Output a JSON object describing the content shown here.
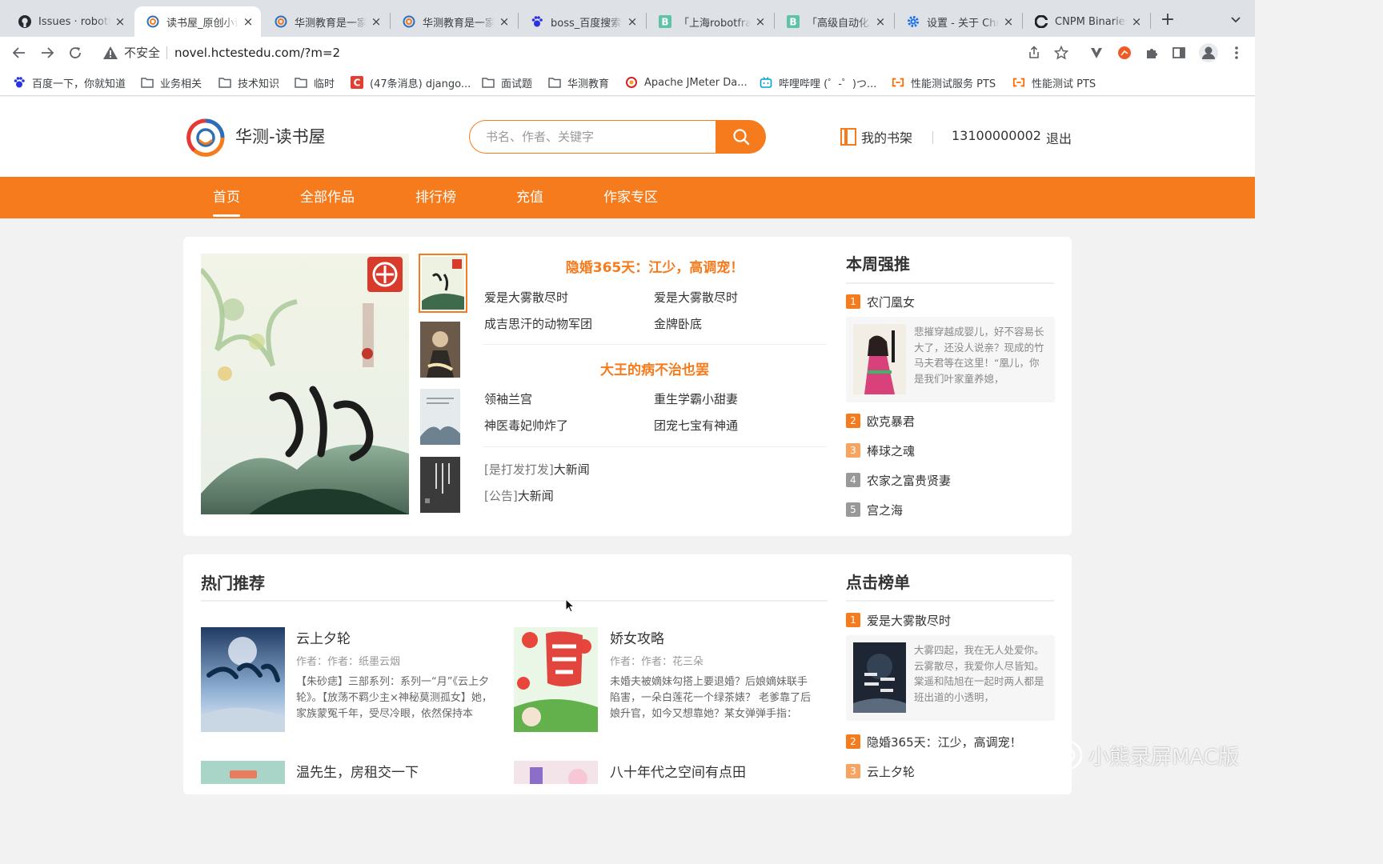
{
  "browser": {
    "tabs": [
      {
        "title": "Issues · robotframework"
      },
      {
        "title": "读书屋_原创小说"
      },
      {
        "title": "华测教育是一家"
      },
      {
        "title": "华测教育是一家"
      },
      {
        "title": "boss_百度搜索"
      },
      {
        "title": "「上海robotframe"
      },
      {
        "title": "「高级自动化测"
      },
      {
        "title": "设置 - 关于 Chrome"
      },
      {
        "title": "CNPM Binaries"
      }
    ],
    "security_label": "不安全",
    "url": "novel.hctestedu.com/?m=2",
    "bookmarks": [
      {
        "label": "百度一下，你就知道"
      },
      {
        "label": "业务相关"
      },
      {
        "label": "技术知识"
      },
      {
        "label": "临时"
      },
      {
        "label": "(47条消息) django..."
      },
      {
        "label": "面试题"
      },
      {
        "label": "华测教育"
      },
      {
        "label": "Apache JMeter Da..."
      },
      {
        "label": "哔哩哔哩 (゜-゜)つ..."
      },
      {
        "label": "性能测试服务 PTS"
      },
      {
        "label": "性能测试 PTS"
      }
    ]
  },
  "site": {
    "name": "华测-读书屋",
    "search_placeholder": "书名、作者、关键字",
    "shelf_label": "我的书架",
    "phone": "13100000002",
    "logout": "退出",
    "brand_color": "#f57b1c",
    "nav": [
      {
        "label": "首页",
        "active": true
      },
      {
        "label": "全部作品"
      },
      {
        "label": "排行榜"
      },
      {
        "label": "充值"
      },
      {
        "label": "作家专区"
      }
    ]
  },
  "featured": {
    "headline1": "隐婚365天：江少，高调宠！",
    "group1": [
      "爱是大雾散尽时",
      "爱是大雾散尽时",
      "成吉思汗的动物军团",
      "金牌卧底"
    ],
    "headline2": "大王的病不治也罢",
    "group2": [
      "领袖兰宫",
      "重生学霸小甜妻",
      "神医毒妃帅炸了",
      "团宠七宝有神通"
    ],
    "news": [
      {
        "tag": "[是打发打发]",
        "title": "大新闻"
      },
      {
        "tag": "[公告]",
        "title": "大新闻"
      }
    ]
  },
  "weekly": {
    "title": "本周强推",
    "items": [
      {
        "rank": "1",
        "title": "农门凰女",
        "desc": "悲摧穿越成婴儿，好不容易长大了，还没人说亲？现成的竹马夫君等在这里！“凰儿，你是我们叶家童养媳，"
      },
      {
        "rank": "2",
        "title": "欧克暴君"
      },
      {
        "rank": "3",
        "title": "棒球之魂"
      },
      {
        "rank": "4",
        "title": "农家之富贵贤妻"
      },
      {
        "rank": "5",
        "title": "宫之海"
      }
    ]
  },
  "hot": {
    "title": "热门推荐",
    "books": [
      {
        "title": "云上夕轮",
        "author": "作者：作者：纸墨云烟",
        "desc": "【朱砂痣】三部系列：系列一“月”《云上夕轮》。【放荡不羁少主×神秘莫测孤女】她，家族蒙冤千年，受尽冷眼，依然保持本"
      },
      {
        "title": "娇女攻略",
        "author": "作者：作者：花三朵",
        "desc": "未婚夫被嫡妹勾搭上要退婚？后娘嫡妹联手陷害，一朵白莲花一个绿茶婊？ 老爹靠了后娘升官，如今又想靠她？某女弹弹手指："
      },
      {
        "title": "温先生，房租交一下"
      },
      {
        "title": "八十年代之空间有点田"
      }
    ]
  },
  "clicks": {
    "title": "点击榜单",
    "items": [
      {
        "rank": "1",
        "title": "爱是大雾散尽时",
        "desc": "大雾四起，我在无人处爱你。云雾散尽，我爱你人尽皆知。棠遥和陆旭在一起时两人都是班出道的小透明，"
      },
      {
        "rank": "2",
        "title": "隐婚365天：江少，高调宠！"
      },
      {
        "rank": "3",
        "title": "云上夕轮"
      }
    ]
  },
  "watermark": "小熊录屏MAC版"
}
